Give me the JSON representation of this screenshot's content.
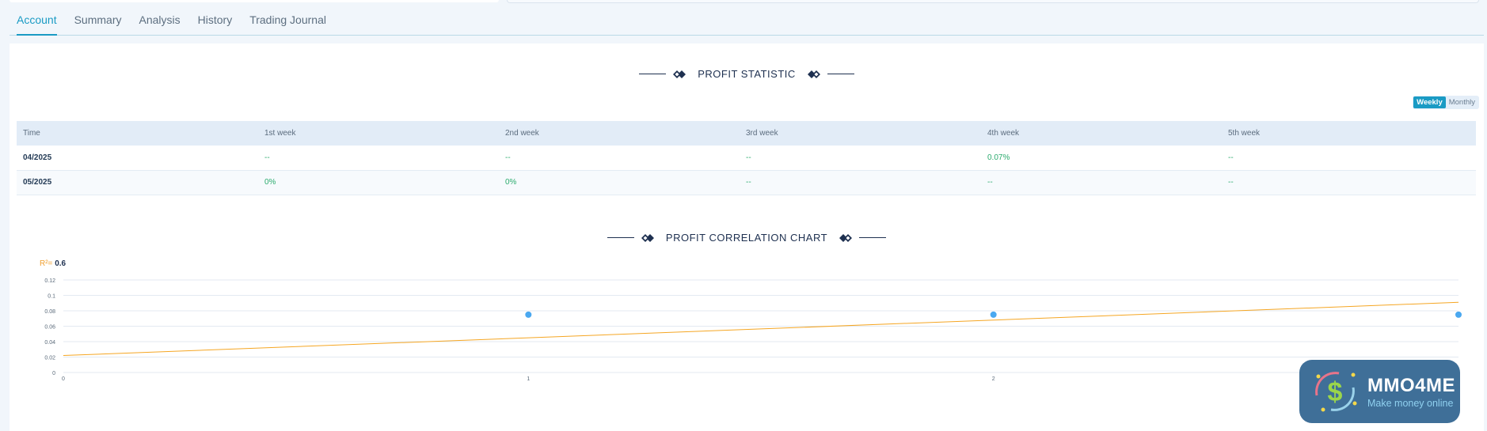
{
  "tabs": [
    {
      "label": "Account",
      "active": true
    },
    {
      "label": "Summary",
      "active": false
    },
    {
      "label": "Analysis",
      "active": false
    },
    {
      "label": "History",
      "active": false
    },
    {
      "label": "Trading Journal",
      "active": false
    }
  ],
  "profit_statistic": {
    "title": "PROFIT STATISTIC",
    "toggle": {
      "weekly": "Weekly",
      "monthly": "Monthly",
      "selected": "Weekly"
    },
    "columns": [
      "Time",
      "1st week",
      "2nd week",
      "3rd week",
      "4th week",
      "5th week"
    ],
    "rows": [
      [
        "04/2025",
        "--",
        "--",
        "--",
        "0.07%",
        "--"
      ],
      [
        "05/2025",
        "0%",
        "0%",
        "--",
        "--",
        "--"
      ]
    ]
  },
  "profit_correlation": {
    "title": "PROFIT CORRELATION CHART",
    "r2_label": "R²=",
    "r2_value": "0.6"
  },
  "chart_data": {
    "type": "scatter",
    "title": "PROFIT CORRELATION CHART",
    "xlabel": "",
    "ylabel": "",
    "x_ticks": [
      "0",
      "1",
      "2"
    ],
    "y_ticks": [
      "0",
      "0.02",
      "0.04",
      "0.06",
      "0.08",
      "0.1",
      "0.12"
    ],
    "xlim": [
      0,
      3
    ],
    "ylim": [
      0,
      0.12
    ],
    "grid": true,
    "series": [
      {
        "points": [
          [
            1,
            0.075
          ],
          [
            2,
            0.075
          ],
          [
            3,
            0.075
          ]
        ],
        "color": "#4aa8f0"
      }
    ],
    "trendline": {
      "from": [
        0,
        0.022
      ],
      "to": [
        3,
        0.091
      ],
      "color": "#f5a623"
    }
  },
  "watermark": {
    "name": "MMO4ME",
    "tagline": "Make money online"
  },
  "colors": {
    "accent": "#1a9bc4",
    "positive": "#2bab6e",
    "trend": "#f5a623",
    "point": "#4aa8f0"
  }
}
